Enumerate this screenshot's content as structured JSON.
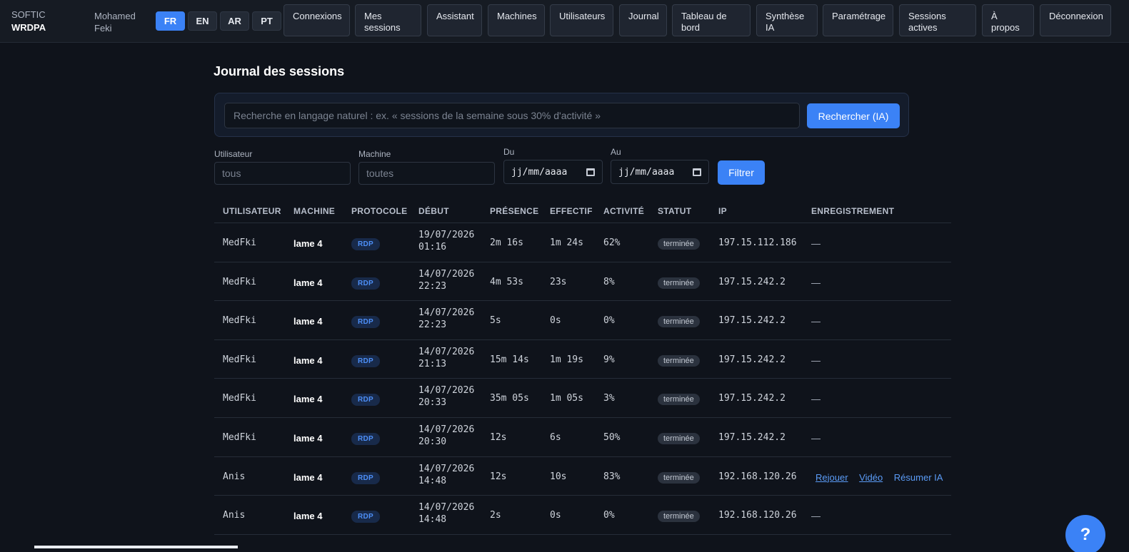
{
  "brand": {
    "line1": "SOFTIC",
    "line2": "WRDPA"
  },
  "user": {
    "name": "Mohamed Feki"
  },
  "languages": [
    {
      "code": "FR",
      "active": true
    },
    {
      "code": "EN",
      "active": false
    },
    {
      "code": "AR",
      "active": false
    },
    {
      "code": "PT",
      "active": false
    }
  ],
  "nav": [
    "Connexions",
    "Mes sessions",
    "Assistant",
    "Machines",
    "Utilisateurs",
    "Journal",
    "Tableau de bord",
    "Synthèse IA",
    "Paramétrage",
    "Sessions actives",
    "À propos",
    "Déconnexion"
  ],
  "page": {
    "title": "Journal des sessions"
  },
  "search": {
    "placeholder": "Recherche en langage naturel : ex. « sessions de la semaine sous 30% d'activité »",
    "button": "Rechercher (IA)"
  },
  "filters": {
    "user_label": "Utilisateur",
    "user_placeholder": "tous",
    "machine_label": "Machine",
    "machine_placeholder": "toutes",
    "from_label": "Du",
    "from_value": "jj/mm/aaaa",
    "to_label": "Au",
    "to_value": "jj/mm/aaaa",
    "button": "Filtrer"
  },
  "table": {
    "columns": [
      "UTILISATEUR",
      "MACHINE",
      "PROTOCOLE",
      "DÉBUT",
      "PRÉSENCE",
      "EFFECTIF",
      "ACTIVITÉ",
      "STATUT",
      "IP",
      "ENREGISTREMENT"
    ],
    "rows": [
      {
        "user": "MedFki",
        "machine": "lame 4",
        "protocol": "RDP",
        "date": "19/07/2026",
        "time": "01:16",
        "presence": "2m 16s",
        "effective": "1m 24s",
        "activity": "62%",
        "status": "terminée",
        "ip": "197.15.112.186",
        "recording": "—"
      },
      {
        "user": "MedFki",
        "machine": "lame 4",
        "protocol": "RDP",
        "date": "14/07/2026",
        "time": "22:23",
        "presence": "4m 53s",
        "effective": "23s",
        "activity": "8%",
        "status": "terminée",
        "ip": "197.15.242.2",
        "recording": "—"
      },
      {
        "user": "MedFki",
        "machine": "lame 4",
        "protocol": "RDP",
        "date": "14/07/2026",
        "time": "22:23",
        "presence": "5s",
        "effective": "0s",
        "activity": "0%",
        "status": "terminée",
        "ip": "197.15.242.2",
        "recording": "—"
      },
      {
        "user": "MedFki",
        "machine": "lame 4",
        "protocol": "RDP",
        "date": "14/07/2026",
        "time": "21:13",
        "presence": "15m 14s",
        "effective": "1m 19s",
        "activity": "9%",
        "status": "terminée",
        "ip": "197.15.242.2",
        "recording": "—"
      },
      {
        "user": "MedFki",
        "machine": "lame 4",
        "protocol": "RDP",
        "date": "14/07/2026",
        "time": "20:33",
        "presence": "35m 05s",
        "effective": "1m 05s",
        "activity": "3%",
        "status": "terminée",
        "ip": "197.15.242.2",
        "recording": "—"
      },
      {
        "user": "MedFki",
        "machine": "lame 4",
        "protocol": "RDP",
        "date": "14/07/2026",
        "time": "20:30",
        "presence": "12s",
        "effective": "6s",
        "activity": "50%",
        "status": "terminée",
        "ip": "197.15.242.2",
        "recording": "—"
      },
      {
        "user": "Anis",
        "machine": "lame 4",
        "protocol": "RDP",
        "date": "14/07/2026",
        "time": "14:48",
        "presence": "12s",
        "effective": "10s",
        "activity": "83%",
        "status": "terminée",
        "ip": "192.168.120.26",
        "recording": "",
        "links": [
          "Rejouer",
          "Vidéo",
          "Résumer IA"
        ]
      },
      {
        "user": "Anis",
        "machine": "lame 4",
        "protocol": "RDP",
        "date": "14/07/2026",
        "time": "14:48",
        "presence": "2s",
        "effective": "0s",
        "activity": "0%",
        "status": "terminée",
        "ip": "192.168.120.26",
        "recording": "—"
      }
    ]
  },
  "help": {
    "label": "?"
  },
  "colors": {
    "accent": "#3b82f6",
    "background": "#0f131b",
    "topbar": "#161b23"
  }
}
